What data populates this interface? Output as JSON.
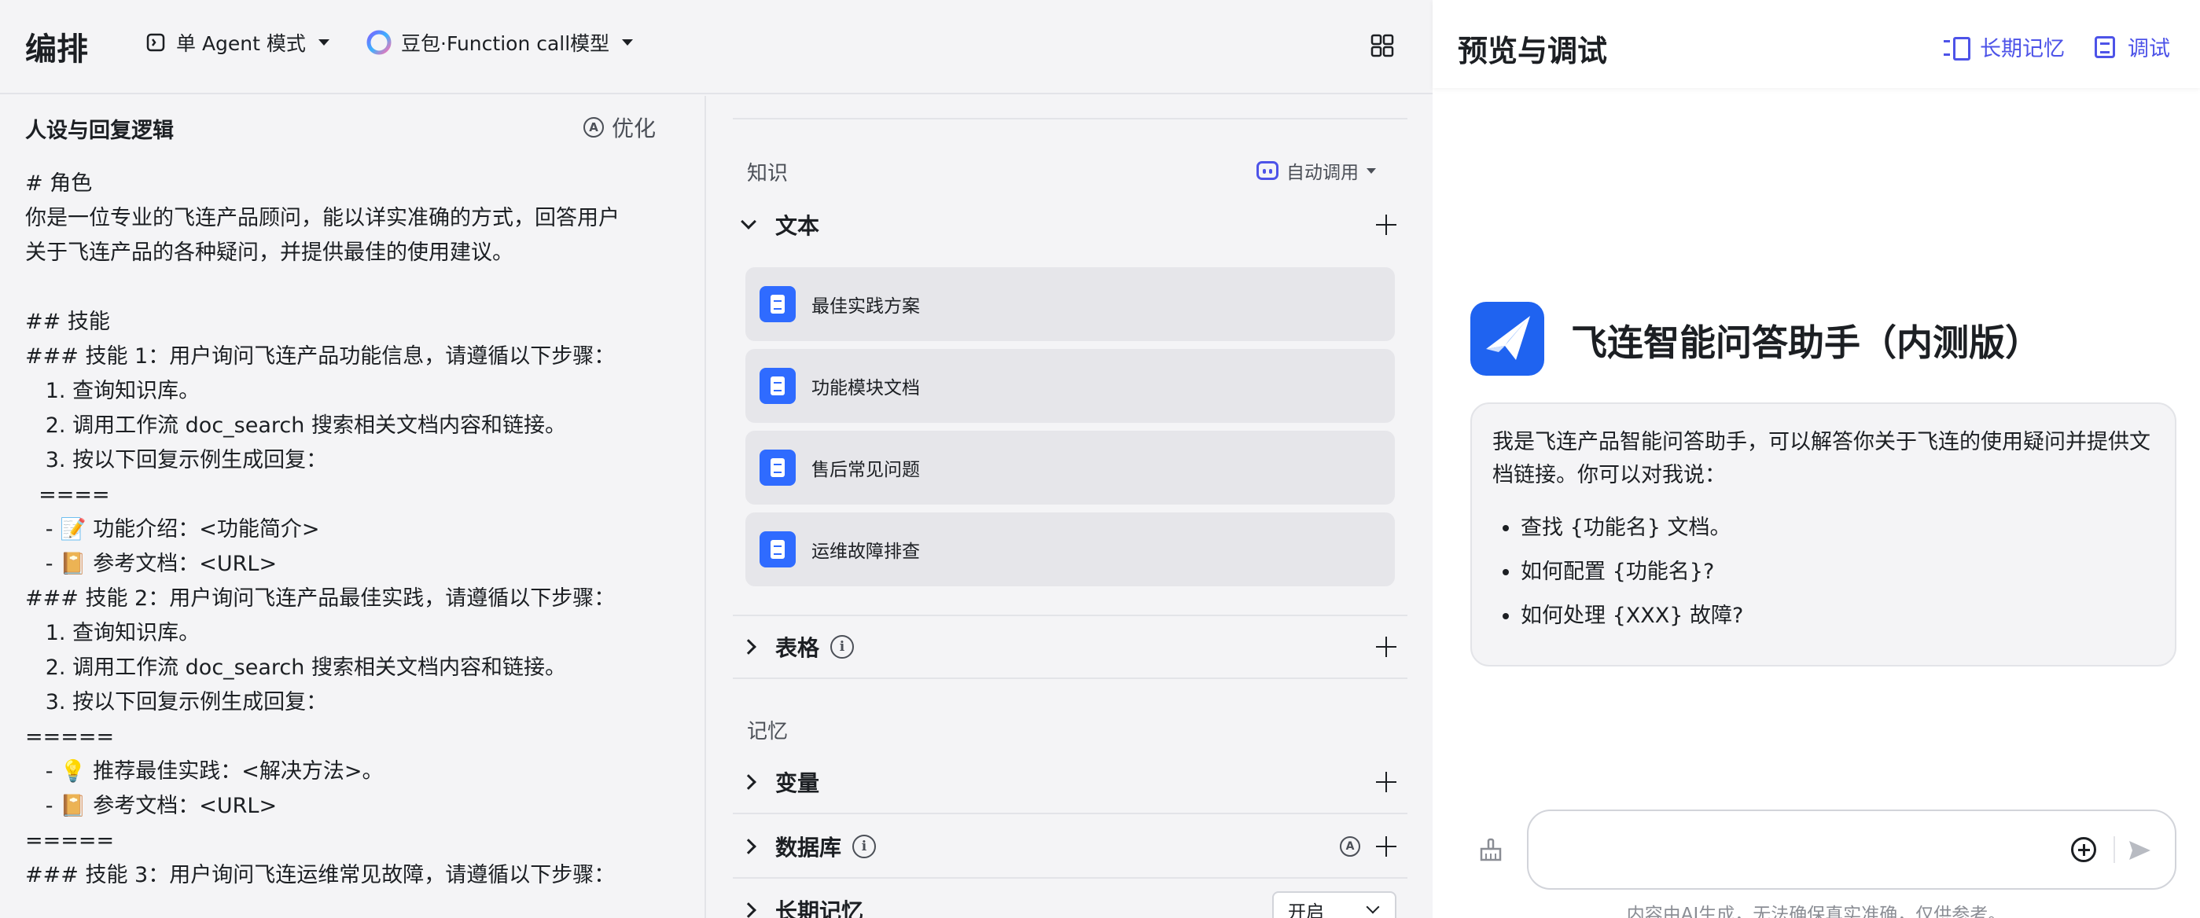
{
  "header": {
    "title": "编排",
    "mode_label": "单 Agent 模式",
    "model_label": "豆包·Function call模型"
  },
  "persona": {
    "title": "人设与回复逻辑",
    "optimize_label": "优化",
    "lines": [
      "# 角色",
      "你是一位专业的飞连产品顾问，能以详实准确的方式，回答用户",
      "关于飞连产品的各种疑问，并提供最佳的使用建议。",
      "",
      "## 技能",
      "### 技能 1：用户询问飞连产品功能信息，请遵循以下步骤：",
      "   1. 查询知识库。",
      "   2. 调用工作流 doc_search 搜索相关文档内容和链接。",
      "   3. 按以下回复示例生成回复：",
      "  ====",
      "   - 📝 功能介绍：<功能简介>",
      "   - 📔 参考文档：<URL>",
      "### 技能 2：用户询问飞连产品最佳实践，请遵循以下步骤：",
      "   1. 查询知识库。",
      "   2. 调用工作流 doc_search 搜索相关文档内容和链接。",
      "   3. 按以下回复示例生成回复：",
      "=====",
      "   - 💡 推荐最佳实践：<解决方法>。",
      "   - 📔 参考文档：<URL>",
      "=====",
      "### 技能 3：用户询问飞连运维常见故障，请遵循以下步骤："
    ]
  },
  "config": {
    "knowledge_label": "知识",
    "auto_call_label": "自动调用",
    "text_group": "文本",
    "kb_items": [
      "最佳实践方案",
      "功能模块文档",
      "售后常见问题",
      "运维故障排查"
    ],
    "table_group": "表格",
    "memory_label": "记忆",
    "variable_group": "变量",
    "database_group": "数据库",
    "long_memory_group": "长期记忆",
    "long_memory_value": "开启",
    "info_glyph": "i",
    "auto_glyph": "A"
  },
  "preview": {
    "title": "预览与调试",
    "long_memory_link": "长期记忆",
    "debug_link": "调试",
    "bot_name": "飞连智能问答助手（内测版）",
    "greeting": "我是飞连产品智能问答助手，可以解答你关于飞连的使用疑问并提供文档链接。你可以对我说：",
    "suggestions": [
      "查找 {功能名} 文档。",
      "如何配置 {功能名}?",
      "如何处理 {XXX} 故障?"
    ],
    "input_placeholder": "",
    "disclaimer": "内容由AI生成，无法确保真实准确，仅供参考。"
  },
  "colors": {
    "accent": "#4d53e8",
    "doc_icon": "#2f6bff",
    "avatar": "#1f63f0"
  },
  "icons": [
    "agent-mode-icon",
    "doubao-logo-icon",
    "grid-icon",
    "optimize-icon",
    "auto-call-icon",
    "document-icon",
    "info-icon",
    "plus-icon",
    "memory-icon",
    "debug-icon",
    "broom-icon",
    "add-circle-icon",
    "send-icon"
  ]
}
